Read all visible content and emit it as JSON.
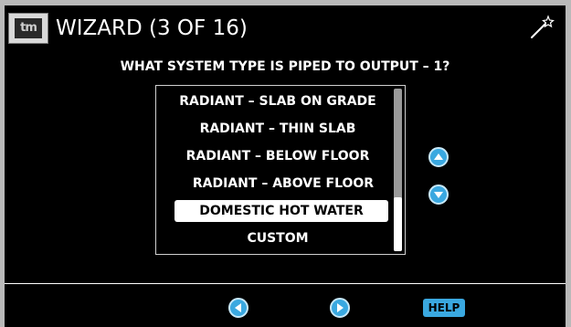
{
  "header": {
    "title": "WIZARD (3 OF 16)",
    "logo_icon": "tekmar-logo-icon",
    "wand_icon": "magic-wand-icon"
  },
  "question": "WHAT SYSTEM TYPE IS PIPED TO OUTPUT – 1?",
  "options": [
    {
      "label": "RADIANT – SLAB ON GRADE",
      "selected": false
    },
    {
      "label": "RADIANT – THIN SLAB",
      "selected": false
    },
    {
      "label": "RADIANT – BELOW FLOOR",
      "selected": false
    },
    {
      "label": "RADIANT – ABOVE FLOOR",
      "selected": false
    },
    {
      "label": "DOMESTIC HOT WATER",
      "selected": true
    },
    {
      "label": "CUSTOM",
      "selected": false
    }
  ],
  "scroll": {
    "position": 1.0
  },
  "buttons": {
    "help_label": "HELP",
    "up_icon": "chevron-up-icon",
    "down_icon": "chevron-down-icon",
    "back_icon": "chevron-left-icon",
    "next_icon": "chevron-right-icon"
  },
  "colors": {
    "accent": "#3aa8e0",
    "background": "#000000",
    "text": "#ffffff"
  }
}
